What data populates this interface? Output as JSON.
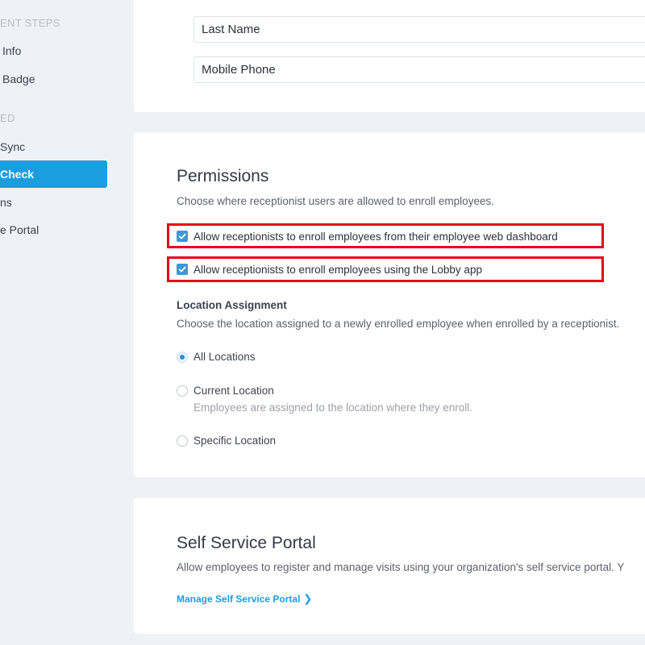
{
  "sidebar": {
    "sections": [
      {
        "label": "ENT STEPS"
      },
      {
        "label": "ED"
      }
    ],
    "items": [
      {
        "label": "Info"
      },
      {
        "label": "Badge"
      },
      {
        "label": "Sync"
      },
      {
        "label": "Check"
      },
      {
        "label": "ns"
      },
      {
        "label": "e Portal"
      }
    ]
  },
  "fields": {
    "last_name": "Last Name",
    "mobile_phone": "Mobile Phone"
  },
  "permissions": {
    "title": "Permissions",
    "description": "Choose where receptionist users are allowed to enroll employees.",
    "checkboxes": [
      {
        "label": "Allow receptionists to enroll employees from their employee web dashboard",
        "checked": true
      },
      {
        "label": "Allow receptionists to enroll employees using the Lobby app",
        "checked": true
      }
    ],
    "location": {
      "title": "Location Assignment",
      "description": "Choose the location assigned to a newly enrolled employee when enrolled by a receptionist.",
      "options": [
        {
          "label": "All Locations",
          "selected": true
        },
        {
          "label": "Current Location",
          "sub": "Employees are assigned to the location where they enroll.",
          "selected": false
        },
        {
          "label": "Specific Location",
          "selected": false
        }
      ]
    }
  },
  "self_service": {
    "title": "Self Service Portal",
    "description": "Allow employees to register and manage visits using your organization's self service portal. Y",
    "link": "Manage Self Service Portal"
  },
  "colors": {
    "accent": "#1a9ee0",
    "highlight": "#e8001c",
    "checkbox": "#3a98d9"
  }
}
